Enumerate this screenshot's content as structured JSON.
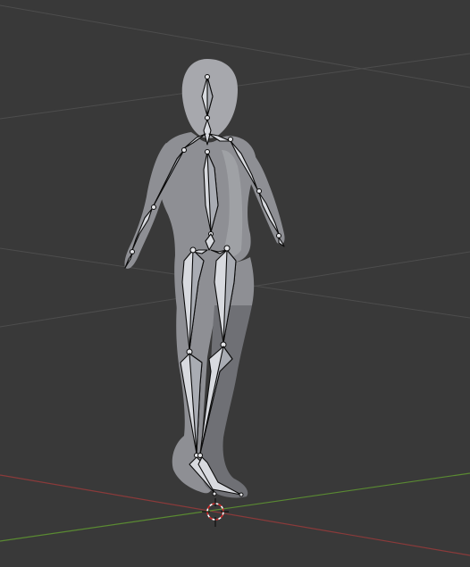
{
  "viewport": {
    "background": "#393939",
    "grid_color": "#4d4d4d",
    "x_axis_color": "#8a3a3a",
    "y_axis_color": "#5a8a32",
    "mesh_color": "#8e8f94",
    "bone_color": "#d8dadf",
    "object": "humanoid-mesh-with-armature",
    "cursor": "3d-cursor-icon"
  }
}
